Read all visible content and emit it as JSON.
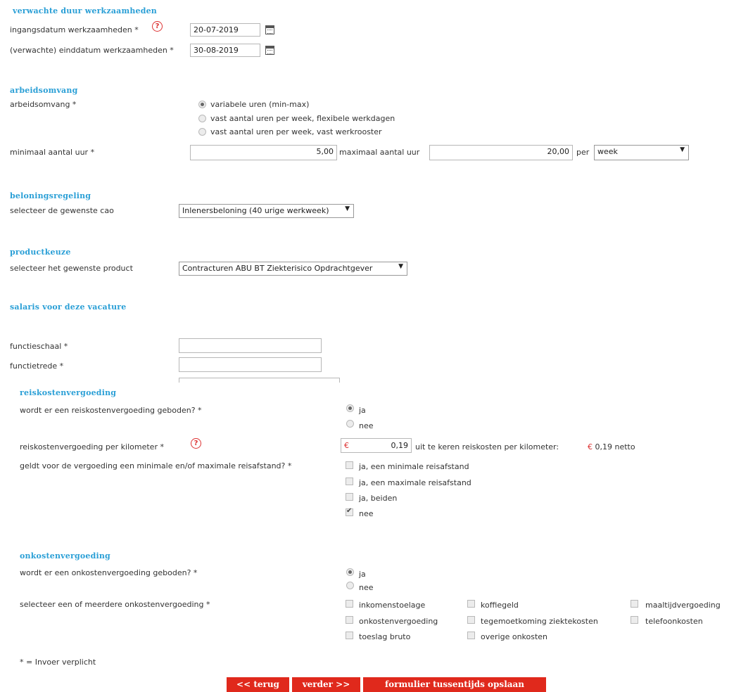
{
  "duur": {
    "title": "verwachte duur werkzaamheden",
    "start_label": "ingangsdatum werkzaamheden *",
    "start_value": "20-07-2019",
    "end_label": "(verwachte) einddatum werkzaamheden *",
    "end_value": "30-08-2019"
  },
  "omvang": {
    "title": "arbeidsomvang",
    "label": "arbeidsomvang *",
    "options": [
      "variabele uren (min-max)",
      "vast aantal uren per week, flexibele werkdagen",
      "vast aantal uren per week, vast werkrooster"
    ],
    "min_label": "minimaal aantal uur *",
    "min_value": "5,00",
    "max_label": "maximaal aantal uur",
    "max_value": "20,00",
    "per_label": "per",
    "per_value": "week"
  },
  "beloning": {
    "title": "beloningsregeling",
    "label": "selecteer de gewenste cao",
    "value": "Inlenersbeloning (40 urige werkweek)"
  },
  "product": {
    "title": "productkeuze",
    "label": "selecteer het gewenste product",
    "value": "Contracturen ABU BT Ziekterisico Opdrachtgever"
  },
  "salaris": {
    "title": "salaris voor deze  vacature",
    "schaal_label": "functieschaal *",
    "trede_label": "functietrede *"
  },
  "reis": {
    "title": "reiskostenvergoeding",
    "question": "wordt er een reiskostenvergoeding geboden? *",
    "options": [
      "ja",
      "nee"
    ],
    "per_km_label": "reiskostenvergoeding per kilometer *",
    "currency": "€",
    "per_km_value": "0,19",
    "uit_label": "uit te keren reiskosten per kilometer:",
    "uit_value": "0,19 netto",
    "afstand_label": "geldt voor de vergoeding een minimale en/of maximale reisafstand? *",
    "afstand_options": [
      "ja, een minimale reisafstand",
      "ja, een maximale reisafstand",
      "ja, beiden",
      "nee"
    ]
  },
  "onkosten": {
    "title": "onkostenvergoeding",
    "question": "wordt er een onkostenvergoeding geboden? *",
    "options": [
      "ja",
      "nee"
    ],
    "select_label": "selecteer een of meerdere onkostenvergoeding *",
    "checks": [
      "inkomenstoelage",
      "koffiegeld",
      "maaltijdvergoeding",
      "onkostenvergoeding",
      "tegemoetkoming ziektekosten",
      "telefoonkosten",
      "toeslag bruto",
      "overige onkosten"
    ]
  },
  "footer": {
    "note": "* = Invoer verplicht",
    "back": "<< terug",
    "next": "verder >>",
    "save": "formulier tussentijds opslaan"
  },
  "colors": {
    "section": "#2a9fd6",
    "button": "#e0291c",
    "required_icon": "#d33"
  },
  "icons": [
    "help-icon",
    "calendar-icon",
    "dropdown-arrow-icon"
  ]
}
